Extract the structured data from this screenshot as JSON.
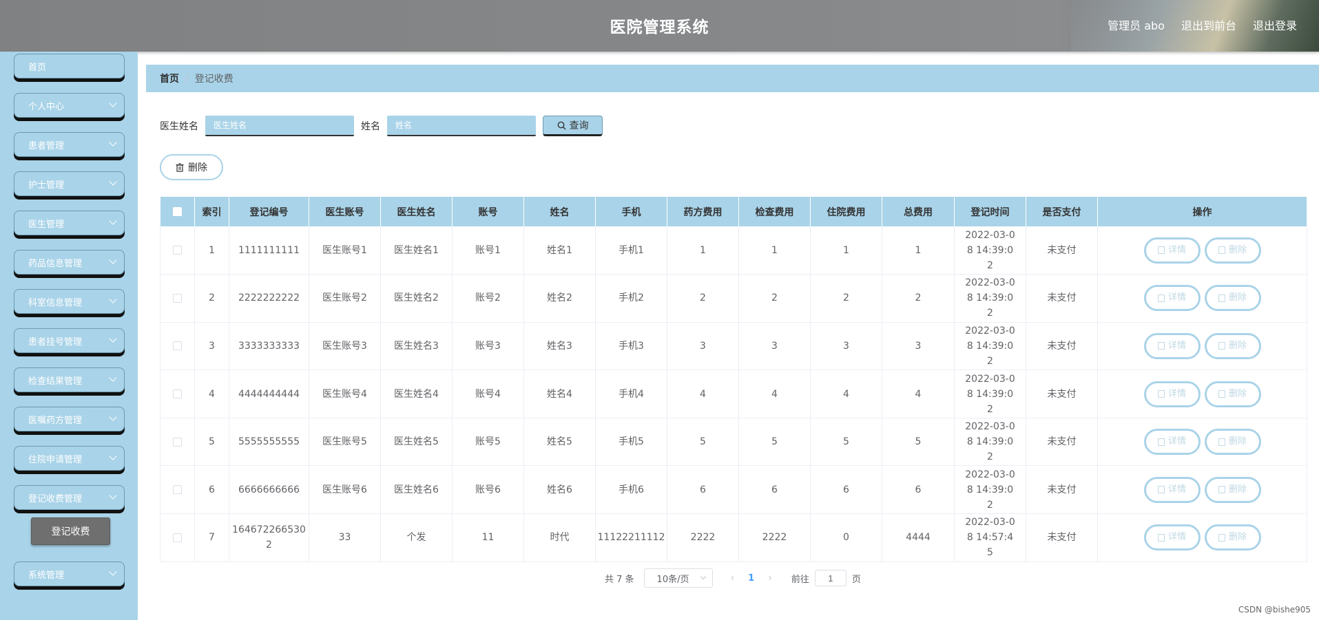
{
  "header": {
    "title": "医院管理系统",
    "user_label": "管理员 abo",
    "to_front_label": "退出到前台",
    "logout_label": "退出登录"
  },
  "sidebar": {
    "items": [
      {
        "label": "首页",
        "has_arrow": false
      },
      {
        "label": "个人中心",
        "has_arrow": true
      },
      {
        "label": "患者管理",
        "has_arrow": true
      },
      {
        "label": "护士管理",
        "has_arrow": true
      },
      {
        "label": "医生管理",
        "has_arrow": true
      },
      {
        "label": "药品信息管理",
        "has_arrow": true
      },
      {
        "label": "科室信息管理",
        "has_arrow": true
      },
      {
        "label": "患者挂号管理",
        "has_arrow": true
      },
      {
        "label": "检查结果管理",
        "has_arrow": true
      },
      {
        "label": "医嘱药方管理",
        "has_arrow": true
      },
      {
        "label": "住院申请管理",
        "has_arrow": true
      },
      {
        "label": "登记收费管理",
        "has_arrow": true
      },
      {
        "label": "系统管理",
        "has_arrow": true
      }
    ],
    "active_sub": "登记收费"
  },
  "breadcrumb": {
    "home": "首页",
    "sep": "/",
    "current": "登记收费"
  },
  "search": {
    "doctor_name_label": "医生姓名",
    "doctor_name_placeholder": "医生姓名",
    "name_label": "姓名",
    "name_placeholder": "姓名",
    "query_label": "查询"
  },
  "toolbar": {
    "delete_label": "删除"
  },
  "table": {
    "columns": [
      "",
      "索引",
      "登记编号",
      "医生账号",
      "医生姓名",
      "账号",
      "姓名",
      "手机",
      "药方费用",
      "检查费用",
      "住院费用",
      "总费用",
      "登记时间",
      "是否支付",
      "操作"
    ],
    "rows": [
      {
        "index": "1",
        "reg_no": "1111111111",
        "doc_acc": "医生账号1",
        "doc_name": "医生姓名1",
        "acc": "账号1",
        "name": "姓名1",
        "phone": "手机1",
        "drug_fee": "1",
        "exam_fee": "1",
        "hosp_fee": "1",
        "total": "1",
        "time": "2022-03-08 14:39:02",
        "paid": "未支付"
      },
      {
        "index": "2",
        "reg_no": "2222222222",
        "doc_acc": "医生账号2",
        "doc_name": "医生姓名2",
        "acc": "账号2",
        "name": "姓名2",
        "phone": "手机2",
        "drug_fee": "2",
        "exam_fee": "2",
        "hosp_fee": "2",
        "total": "2",
        "time": "2022-03-08 14:39:02",
        "paid": "未支付"
      },
      {
        "index": "3",
        "reg_no": "3333333333",
        "doc_acc": "医生账号3",
        "doc_name": "医生姓名3",
        "acc": "账号3",
        "name": "姓名3",
        "phone": "手机3",
        "drug_fee": "3",
        "exam_fee": "3",
        "hosp_fee": "3",
        "total": "3",
        "time": "2022-03-08 14:39:02",
        "paid": "未支付"
      },
      {
        "index": "4",
        "reg_no": "4444444444",
        "doc_acc": "医生账号4",
        "doc_name": "医生姓名4",
        "acc": "账号4",
        "name": "姓名4",
        "phone": "手机4",
        "drug_fee": "4",
        "exam_fee": "4",
        "hosp_fee": "4",
        "total": "4",
        "time": "2022-03-08 14:39:02",
        "paid": "未支付"
      },
      {
        "index": "5",
        "reg_no": "5555555555",
        "doc_acc": "医生账号5",
        "doc_name": "医生姓名5",
        "acc": "账号5",
        "name": "姓名5",
        "phone": "手机5",
        "drug_fee": "5",
        "exam_fee": "5",
        "hosp_fee": "5",
        "total": "5",
        "time": "2022-03-08 14:39:02",
        "paid": "未支付"
      },
      {
        "index": "6",
        "reg_no": "6666666666",
        "doc_acc": "医生账号6",
        "doc_name": "医生姓名6",
        "acc": "账号6",
        "name": "姓名6",
        "phone": "手机6",
        "drug_fee": "6",
        "exam_fee": "6",
        "hosp_fee": "6",
        "total": "6",
        "time": "2022-03-08 14:39:02",
        "paid": "未支付"
      },
      {
        "index": "7",
        "reg_no": "1646722665302",
        "doc_acc": "33",
        "doc_name": "个发",
        "acc": "11",
        "name": "时代",
        "phone": "11122211112",
        "drug_fee": "2222",
        "exam_fee": "2222",
        "hosp_fee": "0",
        "total": "4444",
        "time": "2022-03-08 14:57:45",
        "paid": "未支付"
      }
    ],
    "detail_label": "详情",
    "delete_label": "删除"
  },
  "pagination": {
    "total_text": "共 7 条",
    "page_size": "10条/页",
    "current_page": "1",
    "goto_label": "前往",
    "goto_value": "1",
    "page_suffix": "页"
  },
  "watermark": "CSDN @bishe905",
  "colors": {
    "accent": "#a9d3e8",
    "header_bg": "#86888a",
    "active_sub_bg": "#6f6f6f"
  }
}
